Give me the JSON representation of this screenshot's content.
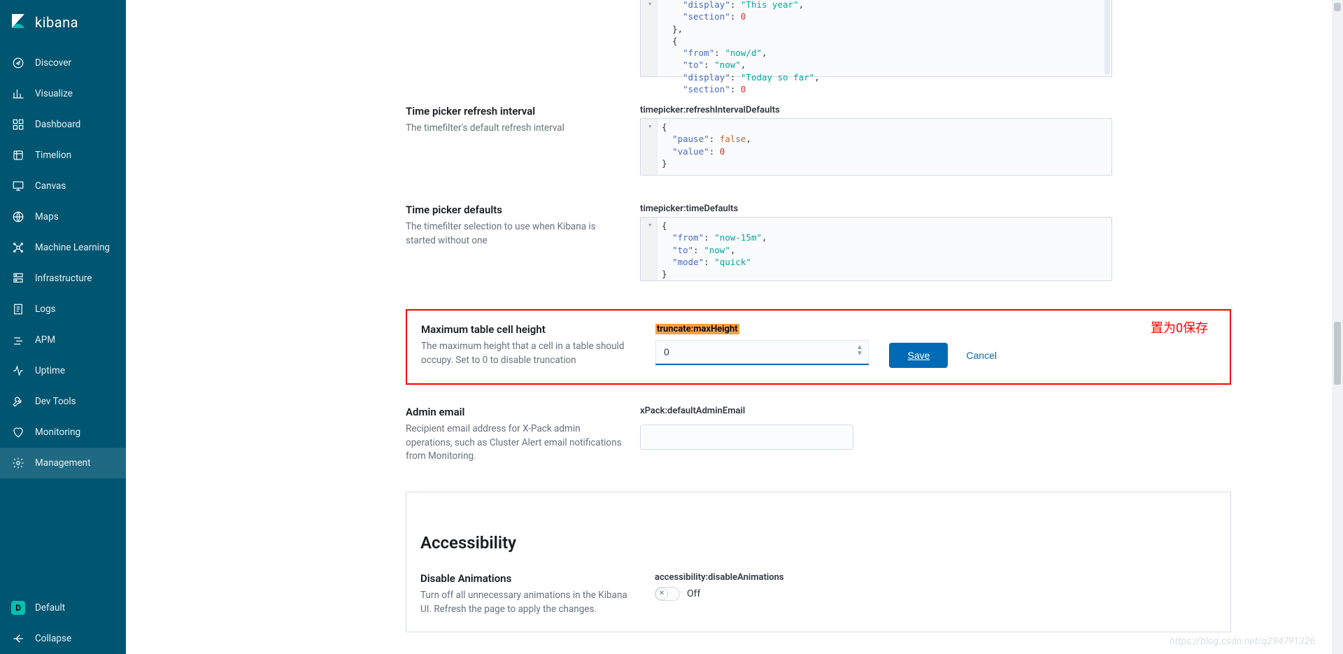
{
  "app": {
    "name": "kibana"
  },
  "sidebar": {
    "items": [
      {
        "id": "discover",
        "label": "Discover"
      },
      {
        "id": "visualize",
        "label": "Visualize"
      },
      {
        "id": "dashboard",
        "label": "Dashboard"
      },
      {
        "id": "timelion",
        "label": "Timelion"
      },
      {
        "id": "canvas",
        "label": "Canvas"
      },
      {
        "id": "maps",
        "label": "Maps"
      },
      {
        "id": "ml",
        "label": "Machine Learning"
      },
      {
        "id": "infra",
        "label": "Infrastructure"
      },
      {
        "id": "logs",
        "label": "Logs"
      },
      {
        "id": "apm",
        "label": "APM"
      },
      {
        "id": "uptime",
        "label": "Uptime"
      },
      {
        "id": "devtools",
        "label": "Dev Tools"
      },
      {
        "id": "monitoring",
        "label": "Monitoring"
      },
      {
        "id": "management",
        "label": "Management"
      }
    ],
    "space": {
      "initial": "D",
      "label": "Default"
    },
    "collapse": "Collapse"
  },
  "settings": {
    "quickRanges": {
      "code": [
        "    \"display\": \"This year\",",
        "    \"section\": 0",
        "  },",
        "  {",
        "    \"from\": \"now/d\",",
        "    \"to\": \"now\",",
        "    \"display\": \"Today so far\",",
        "    \"section\": 0"
      ]
    },
    "refreshInterval": {
      "title": "Time picker refresh interval",
      "desc": "The timefilter's default refresh interval",
      "key": "timepicker:refreshIntervalDefaults",
      "code": [
        "{",
        "  \"pause\": false,",
        "  \"value\": 0",
        "}"
      ]
    },
    "timeDefaults": {
      "title": "Time picker defaults",
      "desc": "The timefilter selection to use when Kibana is started without one",
      "key": "timepicker:timeDefaults",
      "code": [
        "{",
        "  \"from\": \"now-15m\",",
        "  \"to\": \"now\",",
        "  \"mode\": \"quick\"",
        "}"
      ]
    },
    "truncate": {
      "title": "Maximum table cell height",
      "desc": "The maximum height that a cell in a table should occupy. Set to 0 to disable truncation",
      "key": "truncate:maxHeight",
      "value": "0",
      "save": "Save",
      "cancel": "Cancel",
      "annotation": "置为0保存"
    },
    "adminEmail": {
      "title": "Admin email",
      "desc": "Recipient email address for X-Pack admin operations, such as Cluster Alert email notifications from Monitoring.",
      "key": "xPack:defaultAdminEmail",
      "value": ""
    },
    "accessibility": {
      "heading": "Accessibility",
      "disableAnimations": {
        "title": "Disable Animations",
        "desc": "Turn off all unnecessary animations in the Kibana UI. Refresh the page to apply the changes.",
        "key": "accessibility:disableAnimations",
        "off": "Off"
      }
    }
  },
  "watermark": "https://blog.csdn.net/q294791326"
}
